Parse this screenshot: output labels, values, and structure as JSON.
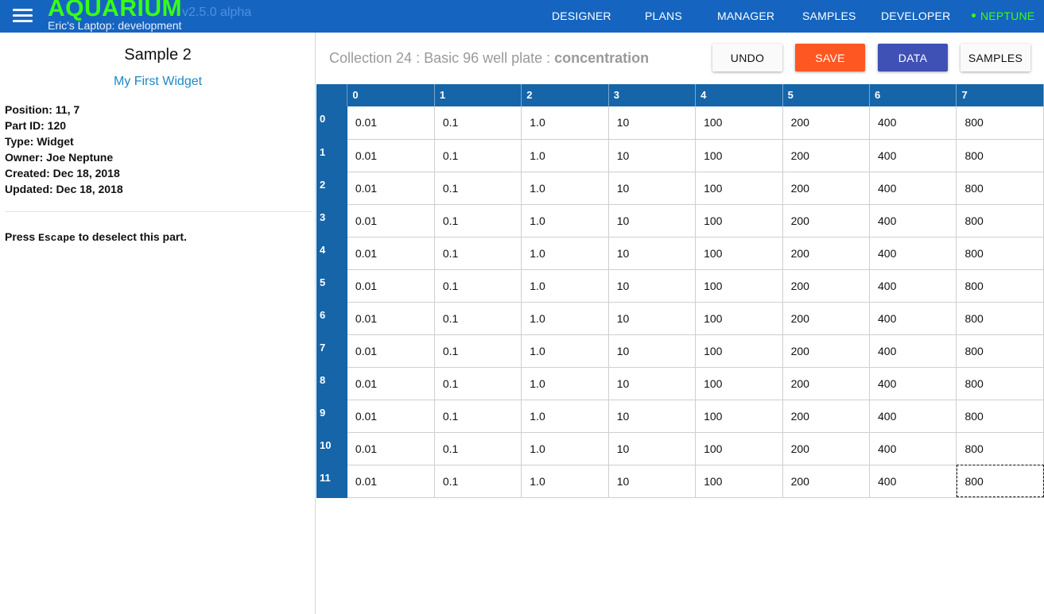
{
  "topbar": {
    "brand": "AQUARIUM",
    "version": "v2.5.0 alpha",
    "environment": "Eric's Laptop: development",
    "nav": [
      "DESIGNER",
      "PLANS",
      "MANAGER",
      "SAMPLES",
      "DEVELOPER"
    ],
    "user": "NEPTUNE"
  },
  "sidebar": {
    "title": "Sample 2",
    "link": "My First Widget",
    "position": "Position: 11, 7",
    "part_id": "Part ID: 120",
    "type": "Type: Widget",
    "owner": "Owner: Joe Neptune",
    "created": "Created: Dec 18, 2018",
    "updated": "Updated: Dec 18, 2018",
    "hint_prefix": "Press ",
    "hint_key": "Escape",
    "hint_suffix": " to deselect this part."
  },
  "collection": {
    "title_prefix": "Collection 24 : Basic 96 well plate : ",
    "title_key": "concentration"
  },
  "toolbar": {
    "undo": "UNDO",
    "save": "SAVE",
    "data": "DATA",
    "samples": "SAMPLES"
  },
  "colors": {
    "topbar": "#1565c0",
    "brand": "#39ff14",
    "save": "#ff5722",
    "data": "#3f51b5",
    "grid_header": "#1565a8"
  },
  "grid": {
    "columns": [
      "0",
      "1",
      "2",
      "3",
      "4",
      "5",
      "6",
      "7"
    ],
    "rows": [
      {
        "label": "0",
        "values": [
          "0.01",
          "0.1",
          "1.0",
          "10",
          "100",
          "200",
          "400",
          "800"
        ]
      },
      {
        "label": "1",
        "values": [
          "0.01",
          "0.1",
          "1.0",
          "10",
          "100",
          "200",
          "400",
          "800"
        ]
      },
      {
        "label": "2",
        "values": [
          "0.01",
          "0.1",
          "1.0",
          "10",
          "100",
          "200",
          "400",
          "800"
        ]
      },
      {
        "label": "3",
        "values": [
          "0.01",
          "0.1",
          "1.0",
          "10",
          "100",
          "200",
          "400",
          "800"
        ]
      },
      {
        "label": "4",
        "values": [
          "0.01",
          "0.1",
          "1.0",
          "10",
          "100",
          "200",
          "400",
          "800"
        ]
      },
      {
        "label": "5",
        "values": [
          "0.01",
          "0.1",
          "1.0",
          "10",
          "100",
          "200",
          "400",
          "800"
        ]
      },
      {
        "label": "6",
        "values": [
          "0.01",
          "0.1",
          "1.0",
          "10",
          "100",
          "200",
          "400",
          "800"
        ]
      },
      {
        "label": "7",
        "values": [
          "0.01",
          "0.1",
          "1.0",
          "10",
          "100",
          "200",
          "400",
          "800"
        ]
      },
      {
        "label": "8",
        "values": [
          "0.01",
          "0.1",
          "1.0",
          "10",
          "100",
          "200",
          "400",
          "800"
        ]
      },
      {
        "label": "9",
        "values": [
          "0.01",
          "0.1",
          "1.0",
          "10",
          "100",
          "200",
          "400",
          "800"
        ]
      },
      {
        "label": "10",
        "values": [
          "0.01",
          "0.1",
          "1.0",
          "10",
          "100",
          "200",
          "400",
          "800"
        ]
      },
      {
        "label": "11",
        "values": [
          "0.01",
          "0.1",
          "1.0",
          "10",
          "100",
          "200",
          "400",
          "800"
        ]
      }
    ],
    "selected": {
      "row": 11,
      "col": 7
    }
  }
}
